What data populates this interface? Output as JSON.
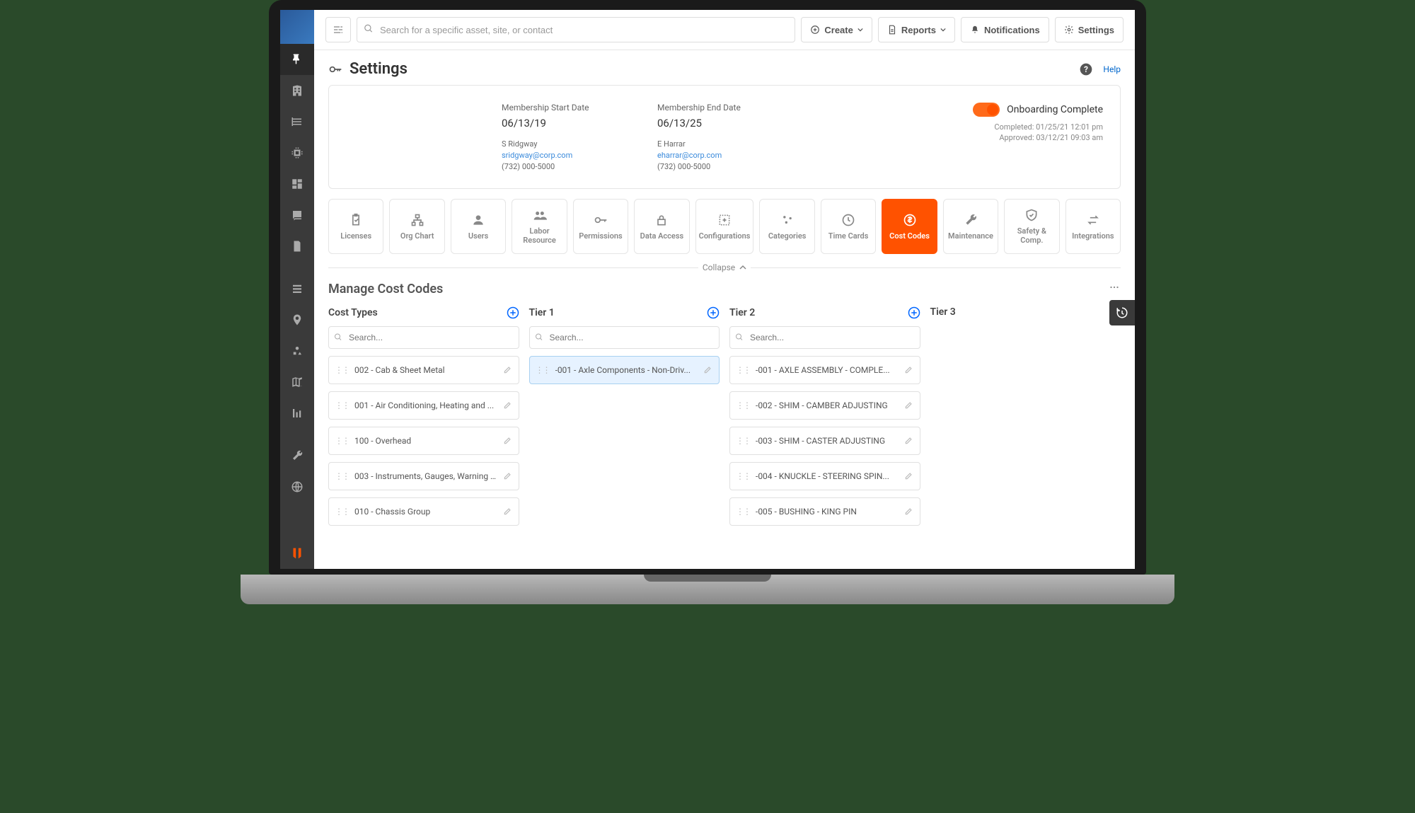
{
  "topbar": {
    "search_placeholder": "Search for a specific asset, site, or contact",
    "create_label": "Create",
    "reports_label": "Reports",
    "notifications_label": "Notifications",
    "settings_label": "Settings"
  },
  "page": {
    "title": "Settings",
    "help_label": "Help"
  },
  "membership": {
    "start_label": "Membership Start Date",
    "start_value": "06/13/19",
    "end_label": "Membership End Date",
    "end_value": "06/13/25",
    "contact1_name": "S Ridgway",
    "contact1_email": "sridgway@corp.com",
    "contact1_phone": "(732) 000-5000",
    "contact2_name": "E Harrar",
    "contact2_email": "eharrar@corp.com",
    "contact2_phone": "(732) 000-5000",
    "onboarding_label": "Onboarding Complete",
    "completed_label": "Completed: 01/25/21 12:01 pm",
    "approved_label": "Approved: 03/12/21 09:03 am"
  },
  "tabs": [
    {
      "label": "Licenses"
    },
    {
      "label": "Org Chart"
    },
    {
      "label": "Users"
    },
    {
      "label": "Labor Resource"
    },
    {
      "label": "Permissions"
    },
    {
      "label": "Data Access"
    },
    {
      "label": "Configurations"
    },
    {
      "label": "Categories"
    },
    {
      "label": "Time Cards"
    },
    {
      "label": "Cost Codes"
    },
    {
      "label": "Maintenance"
    },
    {
      "label": "Safety & Comp."
    },
    {
      "label": "Integrations"
    }
  ],
  "collapse_label": "Collapse",
  "section_title": "Manage Cost Codes",
  "columns": {
    "col0_title": "Cost Types",
    "col1_title": "Tier 1",
    "col2_title": "Tier 2",
    "col3_title": "Tier 3",
    "search_placeholder": "Search..."
  },
  "cost_types": [
    "002 - Cab & Sheet Metal",
    "001 - Air Conditioning, Heating and ...",
    "100 - Overhead",
    "003 - Instruments, Gauges, Warning ...",
    "010 - Chassis Group"
  ],
  "tier1": [
    "-001 - Axle Components - Non-Driv..."
  ],
  "tier2": [
    "-001 - AXLE ASSEMBLY - COMPLE...",
    "-002 - SHIM - CAMBER ADJUSTING",
    "-003 - SHIM - CASTER ADJUSTING",
    "-004 - KNUCKLE - STEERING SPIN...",
    "-005 - BUSHING - KING PIN"
  ]
}
